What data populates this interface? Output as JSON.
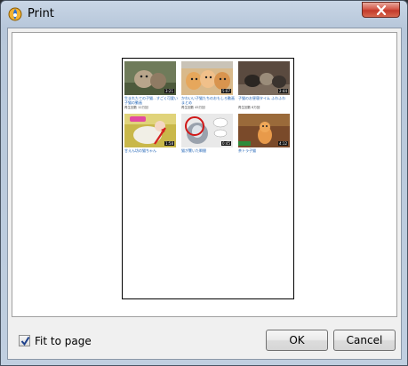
{
  "window": {
    "title": "Print",
    "close_glyph": "×"
  },
  "preview": {
    "videos": [
      {
        "title": "生まれたての子猫…すごく可愛い子猫の動画",
        "meta": "再生回数 12万回",
        "duration": "3:21"
      },
      {
        "title": "かわいい子猫たちのおもしろ動画まとめ",
        "meta": "再生回数 45万回",
        "duration": "5:07"
      },
      {
        "title": "子猫のお昼寝タイム ふわふわ",
        "meta": "再生回数 8万回",
        "duration": "2:44"
      },
      {
        "title": "甘えん坊の猫ちゃん",
        "meta": "",
        "duration": "1:58"
      },
      {
        "title": "猫が驚いた瞬間",
        "meta": "",
        "duration": "0:45"
      },
      {
        "title": "茶トラ子猫",
        "meta": "",
        "duration": "4:12"
      }
    ]
  },
  "options": {
    "fit_to_page_label": "Fit to page",
    "fit_to_page_checked": true
  },
  "buttons": {
    "ok_label": "OK",
    "cancel_label": "Cancel"
  }
}
